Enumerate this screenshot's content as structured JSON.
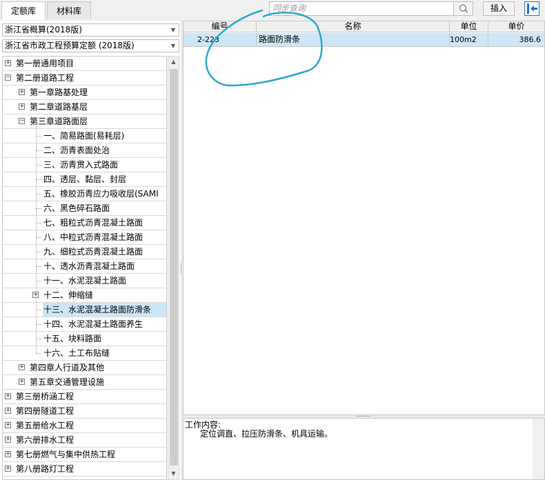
{
  "tabs": [
    {
      "label": "定额库",
      "active": true
    },
    {
      "label": "材料库",
      "active": false
    }
  ],
  "search": {
    "placeholder": "同步查询",
    "icon": "search-icon"
  },
  "toolbar": {
    "insert_label": "插入",
    "exit_icon": "exit-panel-icon"
  },
  "combos": {
    "region": "浙江省概算(2018版)",
    "norm": "浙江省市政工程预算定额 (2018版)"
  },
  "tree": {
    "items": [
      {
        "label": "第一册通用项目",
        "level": 0,
        "expander": "+"
      },
      {
        "label": "第二册道路工程",
        "level": 0,
        "expander": "-"
      },
      {
        "label": "第一章路基处理",
        "level": 1,
        "expander": "+"
      },
      {
        "label": "第二章道路基层",
        "level": 1,
        "expander": "+"
      },
      {
        "label": "第三章道路面层",
        "level": 1,
        "expander": "-"
      },
      {
        "label": "一、简易路面(易耗层)",
        "level": 2,
        "expander": ""
      },
      {
        "label": "二、沥青表面处治",
        "level": 2,
        "expander": ""
      },
      {
        "label": "三、沥青贯入式路面",
        "level": 2,
        "expander": ""
      },
      {
        "label": "四、透层、黏层、封层",
        "level": 2,
        "expander": ""
      },
      {
        "label": "五、橡胶沥青应力吸收层(SAMI",
        "level": 2,
        "expander": ""
      },
      {
        "label": "六、黑色碎石路面",
        "level": 2,
        "expander": ""
      },
      {
        "label": "七、粗粒式沥青混凝土路面",
        "level": 2,
        "expander": ""
      },
      {
        "label": "八、中粒式沥青混凝土路面",
        "level": 2,
        "expander": ""
      },
      {
        "label": "九、细粒式沥青混凝土路面",
        "level": 2,
        "expander": ""
      },
      {
        "label": "十、透水沥青混凝土路面",
        "level": 2,
        "expander": ""
      },
      {
        "label": "十一、水泥混凝土路面",
        "level": 2,
        "expander": ""
      },
      {
        "label": "十二、伸缩缝",
        "level": 2,
        "expander": "+"
      },
      {
        "label": "十三、水泥混凝土路面防滑条",
        "level": 2,
        "expander": "",
        "selected": true
      },
      {
        "label": "十四、水泥混凝土路面养生",
        "level": 2,
        "expander": ""
      },
      {
        "label": "十五、块料路面",
        "level": 2,
        "expander": ""
      },
      {
        "label": "十六、土工布贴缝",
        "level": 2,
        "expander": ""
      },
      {
        "label": "第四章人行道及其他",
        "level": 1,
        "expander": "+"
      },
      {
        "label": "第五章交通管理设施",
        "level": 1,
        "expander": "+"
      },
      {
        "label": "第三册桥涵工程",
        "level": 0,
        "expander": "+"
      },
      {
        "label": "第四册隧道工程",
        "level": 0,
        "expander": "+"
      },
      {
        "label": "第五册给水工程",
        "level": 0,
        "expander": "+"
      },
      {
        "label": "第六册排水工程",
        "level": 0,
        "expander": "+"
      },
      {
        "label": "第七册燃气与集中供热工程",
        "level": 0,
        "expander": "+"
      },
      {
        "label": "第八册路灯工程",
        "level": 0,
        "expander": "+"
      }
    ]
  },
  "grid": {
    "columns": [
      "编号",
      "名称",
      "单位",
      "单价"
    ],
    "rows": [
      {
        "code": "2-223",
        "name": "路面防滑条",
        "unit": "100m2",
        "price": "386.6"
      }
    ]
  },
  "work_content": {
    "title": "工作内容:",
    "body": "定位调直、拉压防滑条、机具运输。"
  },
  "colors": {
    "selection": "#cde6f7",
    "annotation": "#29a8cf",
    "exit_icon": "#2a6fd0"
  }
}
